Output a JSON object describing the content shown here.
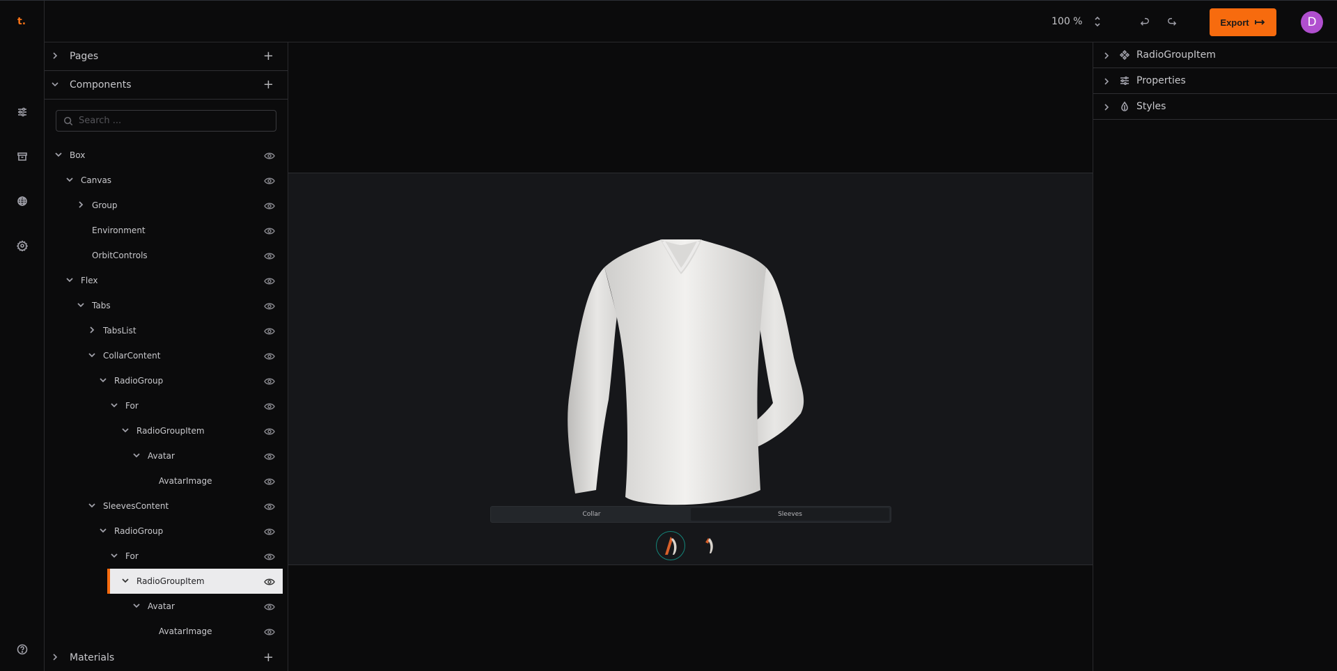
{
  "app": {
    "logo": "t."
  },
  "rail": {
    "items": [
      {
        "name": "properties",
        "icon": "sliders-icon"
      },
      {
        "name": "assets",
        "icon": "archive-icon"
      },
      {
        "name": "web",
        "icon": "globe-icon"
      },
      {
        "name": "settings",
        "icon": "gear-icon"
      }
    ],
    "help_icon": "help-circle-icon"
  },
  "topbar": {
    "zoom": "100 %",
    "undo_icon": "undo-icon",
    "redo_icon": "redo-icon",
    "export_label": "Export",
    "export_icon": "arrow-right-to-line-icon",
    "avatar_initial": "D",
    "accent": "#f76b0e",
    "avatar_color": "#b04fcf"
  },
  "left_panel": {
    "pages": {
      "title": "Pages",
      "expanded": false
    },
    "components": {
      "title": "Components",
      "expanded": true
    },
    "search": {
      "placeholder": "Search ...",
      "value": ""
    },
    "tree": [
      {
        "label": "Box",
        "depth": 0,
        "toggle": "expanded"
      },
      {
        "label": "Canvas",
        "depth": 1,
        "toggle": "expanded"
      },
      {
        "label": "Group",
        "depth": 2,
        "toggle": "collapsed"
      },
      {
        "label": "Environment",
        "depth": 2,
        "toggle": "none"
      },
      {
        "label": "OrbitControls",
        "depth": 2,
        "toggle": "none"
      },
      {
        "label": "Flex",
        "depth": 1,
        "toggle": "expanded"
      },
      {
        "label": "Tabs",
        "depth": 2,
        "toggle": "expanded"
      },
      {
        "label": "TabsList",
        "depth": 3,
        "toggle": "collapsed"
      },
      {
        "label": "CollarContent",
        "depth": 3,
        "toggle": "expanded"
      },
      {
        "label": "RadioGroup",
        "depth": 4,
        "toggle": "expanded"
      },
      {
        "label": "For",
        "depth": 5,
        "toggle": "expanded"
      },
      {
        "label": "RadioGroupItem",
        "depth": 6,
        "toggle": "expanded"
      },
      {
        "label": "Avatar",
        "depth": 7,
        "toggle": "expanded"
      },
      {
        "label": "AvatarImage",
        "depth": 8,
        "toggle": "none"
      },
      {
        "label": "SleevesContent",
        "depth": 3,
        "toggle": "expanded"
      },
      {
        "label": "RadioGroup",
        "depth": 4,
        "toggle": "expanded"
      },
      {
        "label": "For",
        "depth": 5,
        "toggle": "expanded"
      },
      {
        "label": "RadioGroupItem",
        "depth": 6,
        "toggle": "expanded",
        "selected": true
      },
      {
        "label": "Avatar",
        "depth": 7,
        "toggle": "expanded"
      },
      {
        "label": "AvatarImage",
        "depth": 8,
        "toggle": "none"
      }
    ],
    "materials": {
      "title": "Materials",
      "expanded": false
    }
  },
  "canvas": {
    "tabs": [
      {
        "label": "Collar",
        "active": false
      },
      {
        "label": "Sleeves",
        "active": true
      }
    ],
    "radio_items": [
      {
        "name": "sleeve-option-1",
        "checked": true
      },
      {
        "name": "sleeve-option-2",
        "checked": false
      }
    ]
  },
  "right_panel": {
    "sections": [
      {
        "title": "RadioGroupItem",
        "icon": "component-icon"
      },
      {
        "title": "Properties",
        "icon": "sliders-icon"
      },
      {
        "title": "Styles",
        "icon": "droplet-icon"
      }
    ]
  }
}
